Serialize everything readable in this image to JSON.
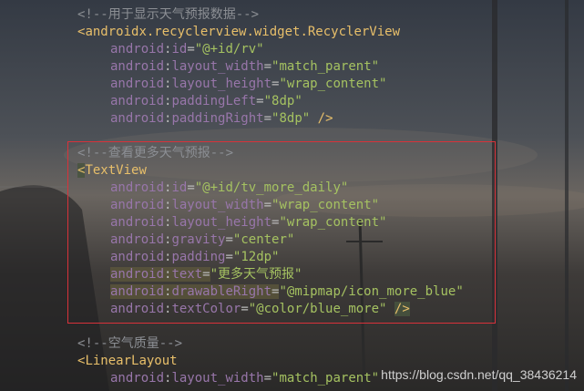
{
  "lines": [
    {
      "t": "comment",
      "text": "<!--用于显示天气预报数据-->"
    },
    {
      "t": "open_tag",
      "tag": "androidx.recyclerview.widget.RecyclerView"
    },
    {
      "t": "attr",
      "ns": "android",
      "name": "id",
      "value": "\"@+id/rv\""
    },
    {
      "t": "attr",
      "ns": "android",
      "name": "layout_width",
      "value": "\"match_parent\""
    },
    {
      "t": "attr",
      "ns": "android",
      "name": "layout_height",
      "value": "\"wrap_content\""
    },
    {
      "t": "attr",
      "ns": "android",
      "name": "paddingLeft",
      "value": "\"8dp\""
    },
    {
      "t": "attr",
      "ns": "android",
      "name": "paddingRight",
      "value": "\"8dp\"",
      "end": " />"
    },
    {
      "t": "blank"
    },
    {
      "t": "comment",
      "text": "<!--查看更多天气预报-->"
    },
    {
      "t": "open_tag",
      "tag": "TextView",
      "hl": true
    },
    {
      "t": "attr",
      "ns": "android",
      "name": "id",
      "value": "\"@+id/tv_more_daily\""
    },
    {
      "t": "attr",
      "ns": "android",
      "name": "layout_width",
      "value": "\"wrap_content\""
    },
    {
      "t": "attr",
      "ns": "android",
      "name": "layout_height",
      "value": "\"wrap_content\""
    },
    {
      "t": "attr",
      "ns": "android",
      "name": "gravity",
      "value": "\"center\""
    },
    {
      "t": "attr",
      "ns": "android",
      "name": "padding",
      "value": "\"12dp\""
    },
    {
      "t": "attr",
      "ns": "android",
      "name": "text",
      "value": "\"更多天气预报\"",
      "hl": true
    },
    {
      "t": "attr",
      "ns": "android",
      "name": "drawableRight",
      "value": "\"@mipmap/icon_more_blue\"",
      "hl": true
    },
    {
      "t": "attr",
      "ns": "android",
      "name": "textColor",
      "value": "\"@color/blue_more\"",
      "end": "/>",
      "endhl": true
    },
    {
      "t": "blank"
    },
    {
      "t": "comment",
      "text": "<!--空气质量-->"
    },
    {
      "t": "open_tag",
      "tag": "LinearLayout"
    },
    {
      "t": "attr",
      "ns": "android",
      "name": "layout_width",
      "value": "\"match_parent\""
    }
  ],
  "watermark": "https://blog.csdn.net/qq_38436214",
  "colors": {
    "selection_border": "#d8323a",
    "tag": "#e8bf6a",
    "namespace": "#9876aa",
    "string": "#a5c261",
    "comment": "#8c8f94"
  }
}
